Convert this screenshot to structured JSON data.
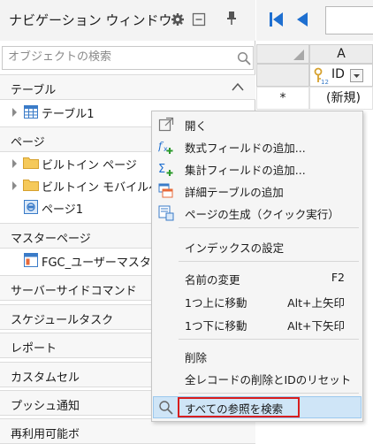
{
  "nav": {
    "title": "ナビゲーション ウィンドウ",
    "search_placeholder": "オブジェクトの検索",
    "sections": {
      "table": "テーブル",
      "page": "ページ",
      "master": "マスターページ",
      "server": "サーバーサイドコマンド",
      "schedule": "スケジュールタスク",
      "report": "レポート",
      "custom": "カスタムセル",
      "push": "プッシュ通知",
      "reuse": "再利用可能ボ"
    },
    "items": {
      "table1": "テーブル1",
      "builtin_page": "ビルトイン ページ",
      "builtin_mobile": "ビルトイン モバイルペー",
      "page1": "ページ1",
      "fgc": "FGC_ユーザーマスター"
    }
  },
  "grid": {
    "column_a": "A",
    "id_header": "ID",
    "new_row_marker": "*",
    "new_row_label": "(新規)"
  },
  "menu": {
    "open": "開く",
    "add_formula_field": "数式フィールドの追加...",
    "add_aggregate_field": "集計フィールドの追加...",
    "add_detail_table": "詳細テーブルの追加",
    "generate_page": "ページの生成（クイック実行）",
    "index_settings": "インデックスの設定",
    "rename": "名前の変更",
    "rename_shortcut": "F2",
    "move_up": "1つ上に移動",
    "move_up_shortcut": "Alt+上矢印",
    "move_down": "1つ下に移動",
    "move_down_shortcut": "Alt+下矢印",
    "delete": "削除",
    "delete_all_reset": "全レコードの削除とIDのリセット",
    "find_all_references": "すべての参照を検索"
  },
  "colors": {
    "accent_blue": "#1e6fd0",
    "highlight_border": "#d81e1e",
    "hover_bg": "#cfe5f7"
  }
}
